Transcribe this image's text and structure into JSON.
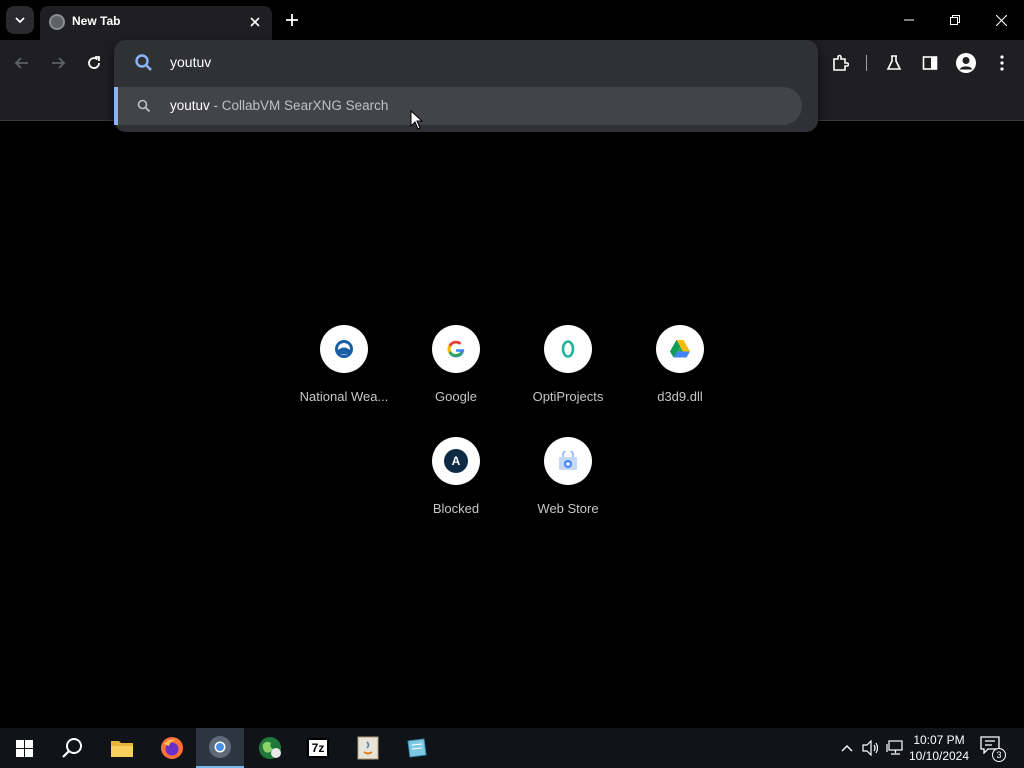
{
  "tab": {
    "title": "New Tab"
  },
  "omnibox": {
    "input_value": "youtuv",
    "suggestion": {
      "query": "youtuv",
      "separator": " - ",
      "description": "CollabVM SearXNG Search"
    }
  },
  "shortcuts": [
    {
      "label": "National Wea...",
      "icon": "noaa-icon"
    },
    {
      "label": "Google",
      "icon": "google-icon"
    },
    {
      "label": "OptiProjects",
      "icon": "optiprojects-icon"
    },
    {
      "label": "d3d9.dll",
      "icon": "google-drive-icon"
    },
    {
      "label": "Blocked",
      "icon": "blocked-icon",
      "letter": "A"
    },
    {
      "label": "Web Store",
      "icon": "web-store-icon"
    }
  ],
  "taskbar": {
    "items": [
      "start-icon",
      "search-icon",
      "file-explorer-icon",
      "firefox-icon",
      "chrome-icon",
      "earth-icon",
      "7zip-icon",
      "java-installer-icon",
      "notepad-icon"
    ],
    "sevenzip_label": "7z",
    "time": "10:07 PM",
    "date": "10/10/2024",
    "notification_count": "3"
  },
  "colors": {
    "accent": "#8ab4f8",
    "background": "#000000",
    "toolbar": "#1f1f22"
  }
}
